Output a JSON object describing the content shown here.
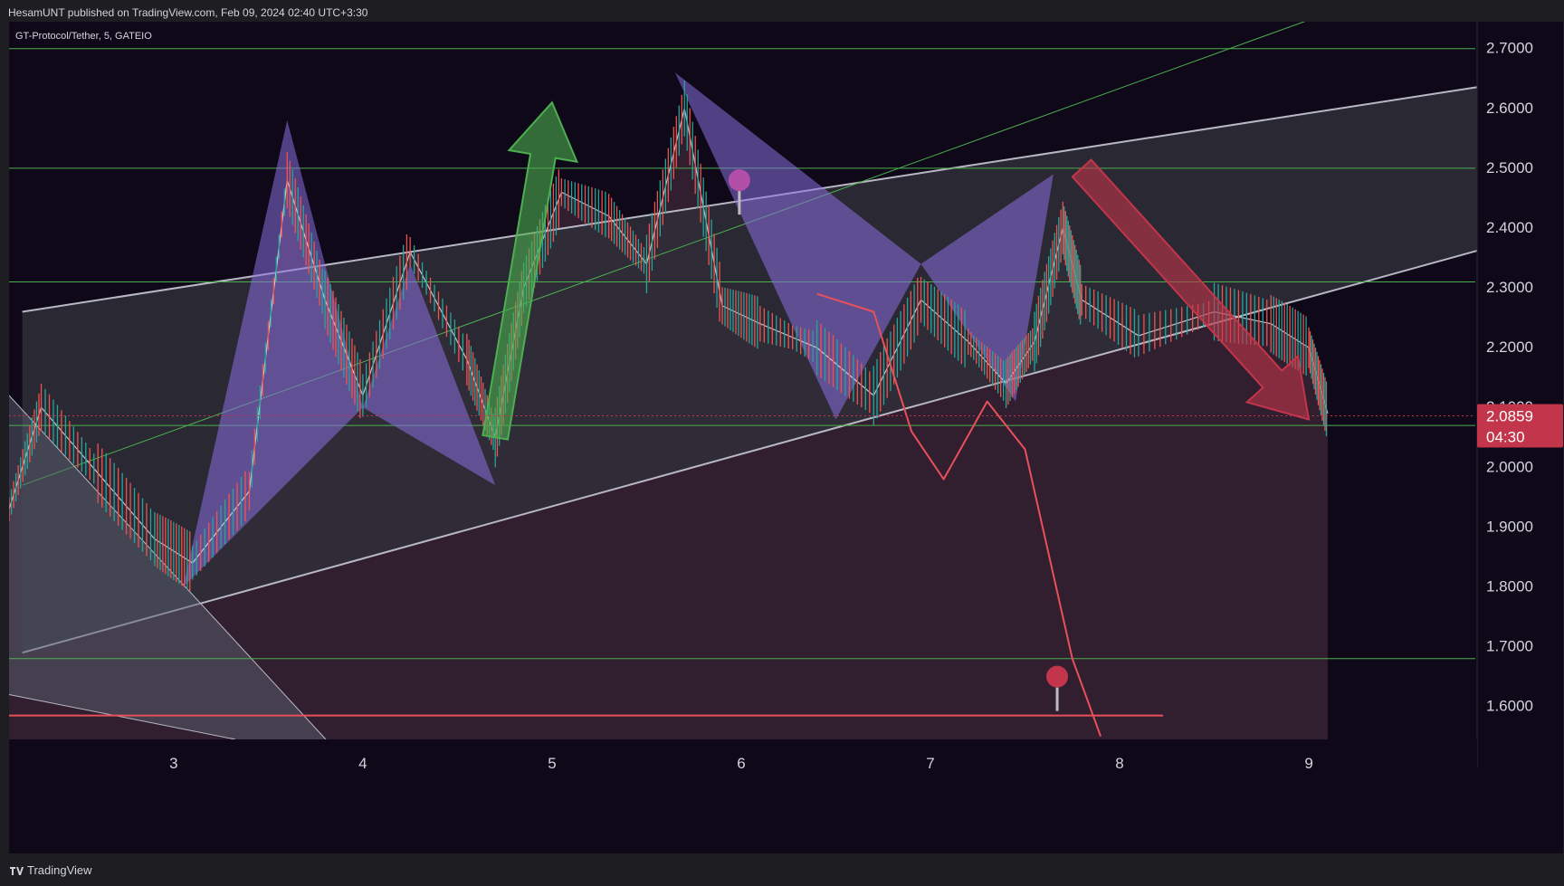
{
  "header": {
    "publish_line": "HesamUNT published on TradingView.com, Feb 09, 2024 02:40 UTC+3:30"
  },
  "symbol_label": "GT-Protocol/Tether, 5, GATEIO",
  "brand": {
    "name": "TradingView",
    "icon": "tradingview-logo-icon"
  },
  "colors": {
    "background": "#0f0818",
    "channel_fill": "#2f2e38",
    "pattern_purple": "#8a6fe0",
    "arrow_green": "#4caf50",
    "arrow_red": "#c2354a",
    "level_line": "#4caf50",
    "price_badge": "#c2354a",
    "forecast_line": "#e8505b",
    "candle_up": "#26a69a",
    "candle_down": "#ef5350"
  },
  "chart_data": {
    "type": "candlestick",
    "title": "GT-Protocol/Tether, 5, GATEIO",
    "x_ticks": [
      "3",
      "4",
      "5",
      "6",
      "7",
      "8",
      "9"
    ],
    "x_tick_days": [
      3,
      4,
      5,
      6,
      7,
      8,
      9
    ],
    "xlim_days": [
      2.13,
      9.88
    ],
    "y_ticks": [
      "2.7000",
      "2.6000",
      "2.5000",
      "2.4000",
      "2.3000",
      "2.2000",
      "2.1000",
      "2.0000",
      "1.9000",
      "1.8000",
      "1.7000",
      "1.6000"
    ],
    "ylim": [
      1.545,
      2.745
    ],
    "last_price": "2.0859",
    "countdown": "04:30",
    "horizontal_levels": [
      2.7,
      2.5,
      2.31,
      2.07,
      1.68
    ],
    "support_red_level": 1.585,
    "price_path": [
      {
        "day": 2.13,
        "price": 1.93
      },
      {
        "day": 2.3,
        "price": 2.1
      },
      {
        "day": 2.6,
        "price": 1.99
      },
      {
        "day": 2.9,
        "price": 1.88
      },
      {
        "day": 3.1,
        "price": 1.84
      },
      {
        "day": 3.4,
        "price": 1.96
      },
      {
        "day": 3.6,
        "price": 2.48
      },
      {
        "day": 3.8,
        "price": 2.28
      },
      {
        "day": 4.0,
        "price": 2.12
      },
      {
        "day": 4.25,
        "price": 2.36
      },
      {
        "day": 4.55,
        "price": 2.18
      },
      {
        "day": 4.7,
        "price": 2.05
      },
      {
        "day": 4.85,
        "price": 2.3
      },
      {
        "day": 5.05,
        "price": 2.46
      },
      {
        "day": 5.3,
        "price": 2.42
      },
      {
        "day": 5.5,
        "price": 2.34
      },
      {
        "day": 5.7,
        "price": 2.6
      },
      {
        "day": 5.9,
        "price": 2.27
      },
      {
        "day": 6.1,
        "price": 2.24
      },
      {
        "day": 6.4,
        "price": 2.2
      },
      {
        "day": 6.7,
        "price": 2.12
      },
      {
        "day": 6.95,
        "price": 2.28
      },
      {
        "day": 7.2,
        "price": 2.21
      },
      {
        "day": 7.4,
        "price": 2.14
      },
      {
        "day": 7.55,
        "price": 2.21
      },
      {
        "day": 7.7,
        "price": 2.4
      },
      {
        "day": 7.8,
        "price": 2.28
      },
      {
        "day": 8.1,
        "price": 2.22
      },
      {
        "day": 8.5,
        "price": 2.26
      },
      {
        "day": 8.8,
        "price": 2.24
      },
      {
        "day": 9.0,
        "price": 2.2
      },
      {
        "day": 9.1,
        "price": 2.09
      }
    ],
    "forecast_path": [
      {
        "day": 6.4,
        "price": 2.29
      },
      {
        "day": 6.7,
        "price": 2.26
      },
      {
        "day": 6.9,
        "price": 2.06
      },
      {
        "day": 7.07,
        "price": 1.98
      },
      {
        "day": 7.3,
        "price": 2.11
      },
      {
        "day": 7.5,
        "price": 2.03
      },
      {
        "day": 7.75,
        "price": 1.68
      },
      {
        "day": 7.9,
        "price": 1.55
      }
    ],
    "channel_upper": [
      {
        "day": 2.2,
        "price": 2.26
      },
      {
        "day": 9.98,
        "price": 2.64
      }
    ],
    "channel_lower": [
      {
        "day": 2.2,
        "price": 1.69
      },
      {
        "day": 9.98,
        "price": 2.37
      }
    ],
    "channel_mid": [
      {
        "day": 2.2,
        "price": 1.97
      },
      {
        "day": 9.98,
        "price": 2.86
      }
    ],
    "harmonic_patterns": [
      {
        "points": [
          {
            "day": 3.05,
            "price": 1.8
          },
          {
            "day": 3.6,
            "price": 2.58
          },
          {
            "day": 4.0,
            "price": 2.1
          },
          {
            "day": 4.25,
            "price": 2.34
          },
          {
            "day": 4.7,
            "price": 1.97
          }
        ]
      },
      {
        "points": [
          {
            "day": 5.65,
            "price": 2.66
          },
          {
            "day": 6.5,
            "price": 2.08
          },
          {
            "day": 6.95,
            "price": 2.34
          },
          {
            "day": 7.45,
            "price": 2.11
          },
          {
            "day": 7.65,
            "price": 2.49
          }
        ]
      }
    ],
    "arrow_up": {
      "from": {
        "day": 4.7,
        "price": 2.05
      },
      "to": {
        "day": 5.0,
        "price": 2.61
      }
    },
    "arrow_down": {
      "from": {
        "day": 7.8,
        "price": 2.5
      },
      "to": {
        "day": 9.0,
        "price": 2.08
      }
    }
  }
}
